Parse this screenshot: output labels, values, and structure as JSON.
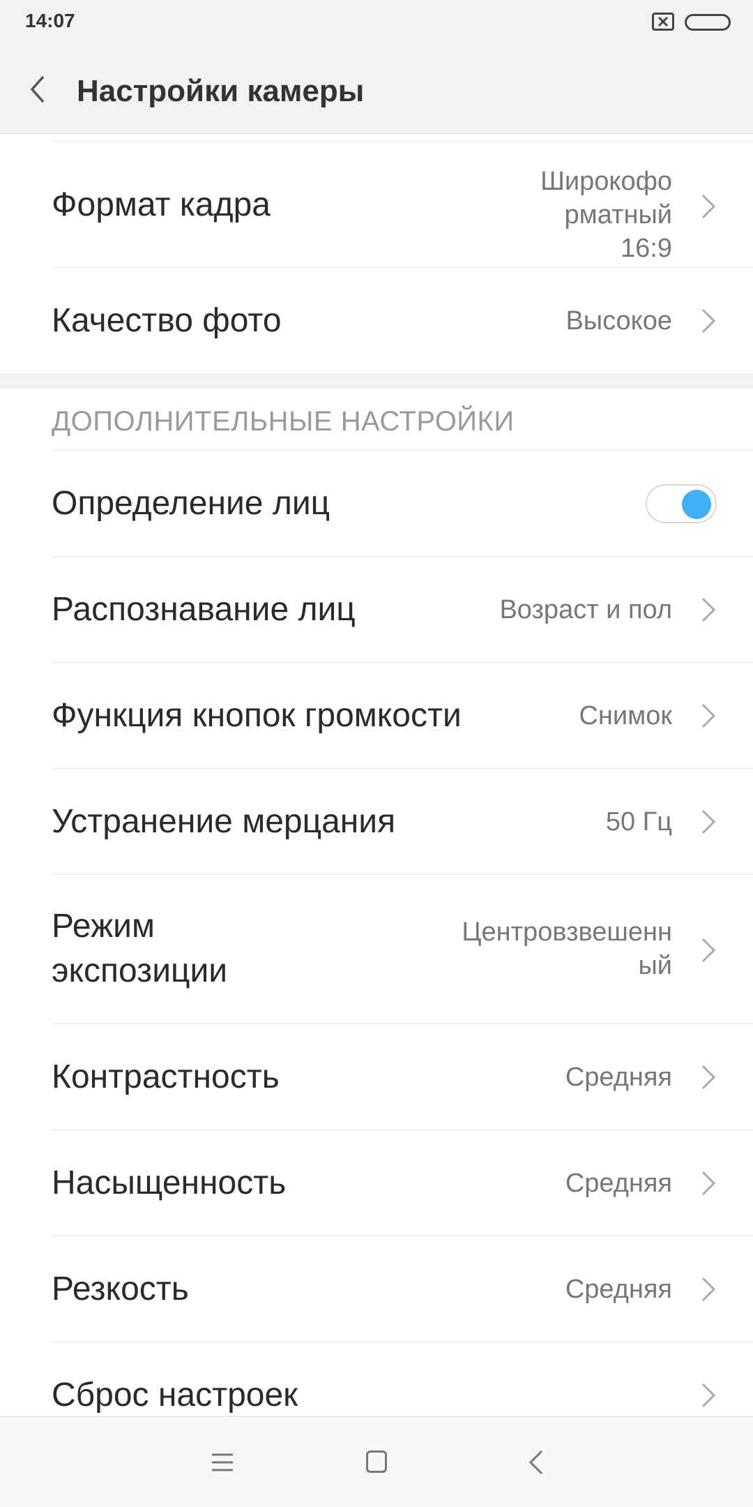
{
  "status": {
    "time": "14:07"
  },
  "header": {
    "title": "Настройки камеры"
  },
  "rows_top": [
    {
      "label": "Формат кадра",
      "value_lines": [
        "Широкофо",
        "рматный",
        "16:9"
      ]
    },
    {
      "label": "Качество фото",
      "value": "Высокое"
    }
  ],
  "section": {
    "title": "ДОПОЛНИТЕЛЬНЫЕ НАСТРОЙКИ"
  },
  "rows": [
    {
      "label": "Определение лиц",
      "toggle_on": true
    },
    {
      "label": "Распознавание лиц",
      "value": "Возраст и пол"
    },
    {
      "label": "Функция кнопок громкости",
      "value": "Снимок"
    },
    {
      "label": "Устранение мерцания",
      "value": "50 Гц"
    },
    {
      "label_lines": [
        "Режим",
        "экспозиции"
      ],
      "value_lines": [
        "Центровзвешенн",
        "ый"
      ]
    },
    {
      "label": "Контрастность",
      "value": "Средняя"
    },
    {
      "label": "Насыщенность",
      "value": "Средняя"
    },
    {
      "label": "Резкость",
      "value": "Средняя"
    },
    {
      "label": "Сброс настроек"
    }
  ],
  "colors": {
    "accent": "#3fb0f7",
    "background": "#ffffff",
    "header_bg": "#f2f2f2"
  },
  "icons": [
    "sim-icon",
    "battery-icon",
    "back-arrow-icon",
    "chevron-right-icon",
    "menu-icon",
    "home-icon",
    "back-icon"
  ]
}
